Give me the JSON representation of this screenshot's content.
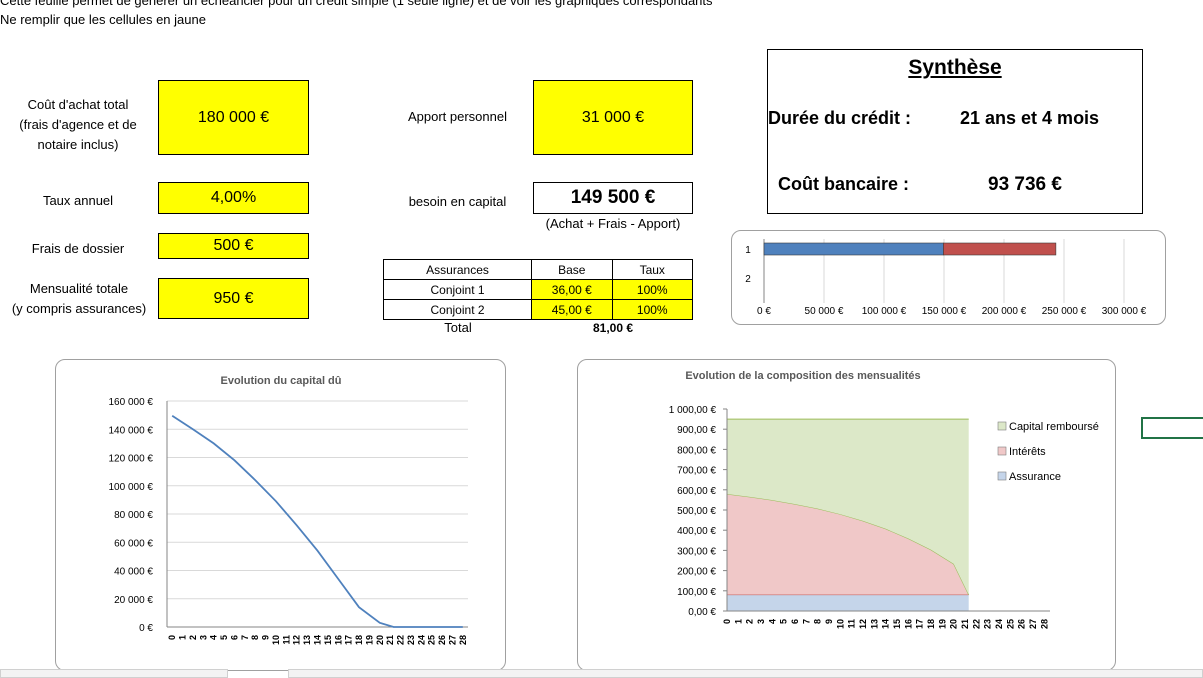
{
  "intro": {
    "line1": "Cette feuille permet de générer un échéancier pour un crédit simple (1 seule ligne) et de voir les graphiques correspondants",
    "line2": "Ne remplir que les cellules en jaune"
  },
  "inputs": {
    "cout_achat_label_1": "Coût d'achat total",
    "cout_achat_label_2": "(frais d'agence et de",
    "cout_achat_label_3": "notaire inclus)",
    "cout_achat_value": "180 000 €",
    "taux_label": "Taux annuel",
    "taux_value": "4,00%",
    "frais_label": "Frais de dossier",
    "frais_value": "500 €",
    "mensualite_label_1": "Mensualité totale",
    "mensualite_label_2": "(y compris assurances)",
    "mensualite_value": "950 €",
    "apport_label": "Apport personnel",
    "apport_value": "31 000 €",
    "besoin_label": "besoin en capital",
    "besoin_value": "149 500 €",
    "besoin_note": "(Achat + Frais - Apport)"
  },
  "assurances": {
    "headers": [
      "Assurances",
      "Base",
      "Taux"
    ],
    "rows": [
      {
        "name": "Conjoint 1",
        "base": "36,00 €",
        "taux": "100%"
      },
      {
        "name": "Conjoint 2",
        "base": "45,00 €",
        "taux": "100%"
      }
    ],
    "total_label": "Total",
    "total_value": "81,00 €"
  },
  "synthese": {
    "title": "Synthèse",
    "duree_label": "Durée du crédit :",
    "duree_value": "21 ans et 4 mois",
    "cout_label": "Coût bancaire :",
    "cout_value": "93 736 €"
  },
  "colors": {
    "yellow": "#ffff00",
    "blue": "#4f81bd",
    "red": "#c0504d",
    "green_fill": "#dce8c8",
    "green_line": "#9bbb59",
    "pink_fill": "#f0c8c8",
    "blue_fill": "#c5d5ea"
  },
  "chart_data": [
    {
      "type": "bar",
      "orientation": "horizontal",
      "stacked": true,
      "categories": [
        "1",
        "2"
      ],
      "series": [
        {
          "values": [
            149500,
            0
          ],
          "color": "#4f81bd"
        },
        {
          "values": [
            93736,
            0
          ],
          "color": "#c0504d"
        }
      ],
      "xlim": [
        0,
        300000
      ],
      "xticks": [
        "0 €",
        "50 000 €",
        "100 000 €",
        "150 000 €",
        "200 000 €",
        "250 000 €",
        "300 000 €"
      ],
      "grid": true
    },
    {
      "type": "line",
      "title": "Evolution du capital dû",
      "x": [
        0,
        2,
        4,
        6,
        8,
        10,
        12,
        14,
        16,
        18,
        20,
        21.33,
        28
      ],
      "values": [
        149500,
        140000,
        130000,
        118000,
        104000,
        89000,
        72000,
        54000,
        34000,
        14000,
        3000,
        0,
        0
      ],
      "ylim": [
        0,
        160000
      ],
      "yticks": [
        "160 000 €",
        "140 000 €",
        "120 000 €",
        "100 000 €",
        "80 000 €",
        "60 000 €",
        "40 000 €",
        "20 000 €",
        "0 €"
      ],
      "xticks": [
        "0",
        "1",
        "2",
        "3",
        "4",
        "5",
        "6",
        "7",
        "8",
        "9",
        "10",
        "11",
        "12",
        "13",
        "14",
        "15",
        "16",
        "17",
        "18",
        "19",
        "20",
        "21",
        "22",
        "23",
        "24",
        "25",
        "26",
        "27",
        "28"
      ],
      "grid": true
    },
    {
      "type": "area",
      "stacked": true,
      "title": "Evolution de la composition des mensualités",
      "x": [
        0,
        2,
        4,
        6,
        8,
        10,
        12,
        14,
        16,
        18,
        20,
        21.33
      ],
      "series": [
        {
          "name": "Assurance",
          "values": [
            81,
            81,
            81,
            81,
            81,
            81,
            81,
            81,
            81,
            81,
            81,
            81
          ],
          "color": "#c5d5ea"
        },
        {
          "name": "Intérêts",
          "values": [
            498,
            484,
            468,
            448,
            426,
            398,
            365,
            326,
            278,
            222,
            152,
            0
          ],
          "color": "#f0c8c8"
        },
        {
          "name": "Capital remboursé",
          "values": [
            371,
            385,
            401,
            421,
            443,
            471,
            504,
            543,
            591,
            647,
            717,
            869
          ],
          "color": "#dce8c8"
        }
      ],
      "ylim": [
        0,
        1000
      ],
      "yticks": [
        "1 000,00 €",
        "900,00 €",
        "800,00 €",
        "700,00 €",
        "600,00 €",
        "500,00 €",
        "400,00 €",
        "300,00 €",
        "200,00 €",
        "100,00 €",
        "0,00 €"
      ],
      "xticks": [
        "0",
        "1",
        "2",
        "3",
        "4",
        "5",
        "6",
        "7",
        "8",
        "9",
        "10",
        "11",
        "12",
        "13",
        "14",
        "15",
        "16",
        "17",
        "18",
        "19",
        "20",
        "21",
        "22",
        "23",
        "24",
        "25",
        "26",
        "27",
        "28"
      ],
      "legend": "right"
    }
  ]
}
